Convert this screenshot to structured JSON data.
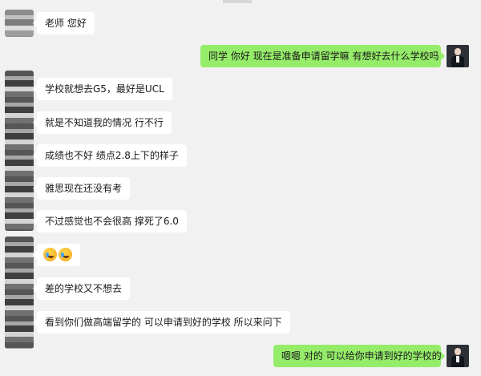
{
  "conversation": {
    "messages": [
      {
        "side": "left",
        "text": "老师 您好"
      },
      {
        "side": "right",
        "text": "同学 你好   现在是准备申请留学嘛 有想好去什么学校吗"
      },
      {
        "side": "left",
        "text": "学校就想去G5，最好是UCL"
      },
      {
        "side": "left",
        "text": "就是不知道我的情况 行不行"
      },
      {
        "side": "left",
        "text": "成绩也不好  绩点2.8上下的样子"
      },
      {
        "side": "left",
        "text": "雅思现在还没有考"
      },
      {
        "side": "left",
        "text": "不过感觉也不会很高 撑死了6.0"
      },
      {
        "side": "left",
        "emoji": [
          "sweat-smile-emoji",
          "sweat-smile-emoji"
        ]
      },
      {
        "side": "left",
        "text": "差的学校又不想去"
      },
      {
        "side": "left",
        "text": "看到你们做高端留学的 可以申请到好的学校 所以来问下"
      },
      {
        "side": "right",
        "text": "嗯嗯 对的 可以给你申请到好的学校的"
      }
    ]
  },
  "colors": {
    "background": "#f1f1f1",
    "incoming_bubble": "#ffffff",
    "outgoing_bubble": "#95ec69"
  }
}
